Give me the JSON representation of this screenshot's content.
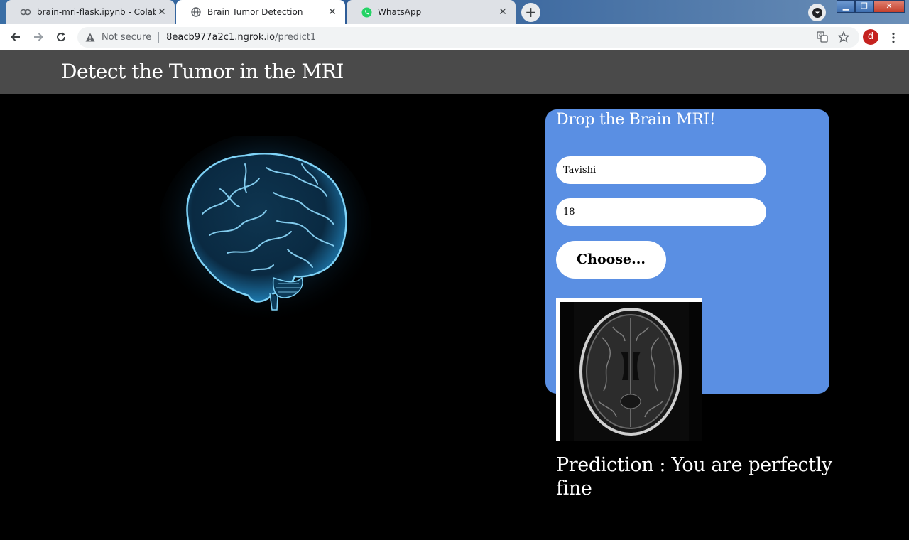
{
  "browser": {
    "tabs": [
      {
        "label": "brain-mri-flask.ipynb - Colaborat",
        "icon": "colab-icon",
        "active": false
      },
      {
        "label": "Brain Tumor Detection",
        "icon": "globe-icon",
        "active": true
      },
      {
        "label": "WhatsApp",
        "icon": "whatsapp-icon",
        "active": false
      }
    ],
    "new_tab": "+",
    "security_label": "Not secure",
    "url_host": "8eacb977a2c1.ngrok.io",
    "url_path": "/predict1",
    "avatar_letter": "d"
  },
  "page": {
    "title": "Detect the Tumor in the MRI",
    "panel": {
      "title": "Drop the Brain MRI!",
      "name_value": "Tavishi",
      "age_value": "18",
      "choose_label": "Choose..."
    },
    "prediction_text": "Prediction : You are perfectly fine"
  },
  "colors": {
    "header_bar": "#4a4a4a",
    "panel_bg": "#5a8fe3",
    "page_bg": "#000000",
    "brain_glow": "#4fb6e8"
  }
}
